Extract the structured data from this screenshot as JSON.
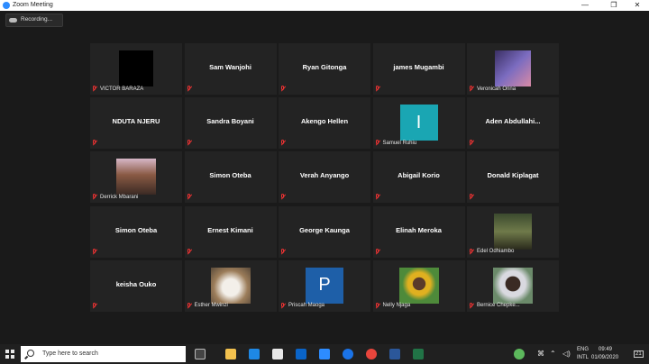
{
  "window": {
    "title": "Zoom Meeting",
    "controls": [
      "—",
      "❐",
      "✕"
    ]
  },
  "recording": {
    "label": "Recording..."
  },
  "colors": {
    "accent": "#2d8cff",
    "mute": "#e53935",
    "tile_bg": "#232323"
  },
  "participants": [
    {
      "name": "VICTOR BARAZA",
      "video": "black-avatar",
      "muted": true
    },
    {
      "name": "Sam Wanjohi",
      "video": "name-only",
      "muted": true
    },
    {
      "name": "Ryan Gitonga",
      "video": "name-only",
      "muted": true
    },
    {
      "name": "james Mugambi",
      "video": "name-only",
      "muted": true
    },
    {
      "name": "Veronicah Orina",
      "video": "photo",
      "muted": true
    },
    {
      "name": "NDUTA NJERU",
      "video": "name-only",
      "muted": true
    },
    {
      "name": "Sandra Boyani",
      "video": "name-only",
      "muted": true
    },
    {
      "name": "Akengo Hellen",
      "video": "name-only",
      "muted": true
    },
    {
      "name": "Samuel Ruhiu",
      "video": "letter-avatar",
      "avatar_letter": "I",
      "muted": true
    },
    {
      "name": "Aden Abdullahi...",
      "video": "name-only",
      "muted": true
    },
    {
      "name": "Derrick Mbarani",
      "video": "photo",
      "muted": true
    },
    {
      "name": "Simon Oteba",
      "video": "name-only",
      "muted": true
    },
    {
      "name": "Verah Anyango",
      "video": "name-only",
      "muted": true
    },
    {
      "name": "Abigail Korio",
      "video": "name-only",
      "muted": true
    },
    {
      "name": "Donald Kiplagat",
      "video": "name-only",
      "muted": true
    },
    {
      "name": "Simon Oteba",
      "video": "name-only",
      "muted": true
    },
    {
      "name": "Ernest Kimani",
      "video": "name-only",
      "muted": true
    },
    {
      "name": "George Kaunga",
      "video": "name-only",
      "muted": true
    },
    {
      "name": "Elinah Meroka",
      "video": "name-only",
      "muted": true
    },
    {
      "name": "Edel Odhiambo",
      "video": "photo",
      "muted": true
    },
    {
      "name": "keisha Ouko",
      "video": "name-only",
      "muted": true
    },
    {
      "name": "Esther Mwinzi",
      "video": "photo",
      "muted": true
    },
    {
      "name": "Priscah Maoga",
      "video": "letter-avatar",
      "avatar_letter": "P",
      "muted": true
    },
    {
      "name": "Nelly Njaga",
      "video": "photo",
      "muted": true
    },
    {
      "name": "Bernice Chepke...",
      "video": "photo",
      "muted": true
    }
  ],
  "taskbar": {
    "search_placeholder": "Type here to search",
    "lang": "ENG",
    "layout": "INTL",
    "time": "09:49",
    "date": "01/09/2020",
    "notifications": "21"
  }
}
